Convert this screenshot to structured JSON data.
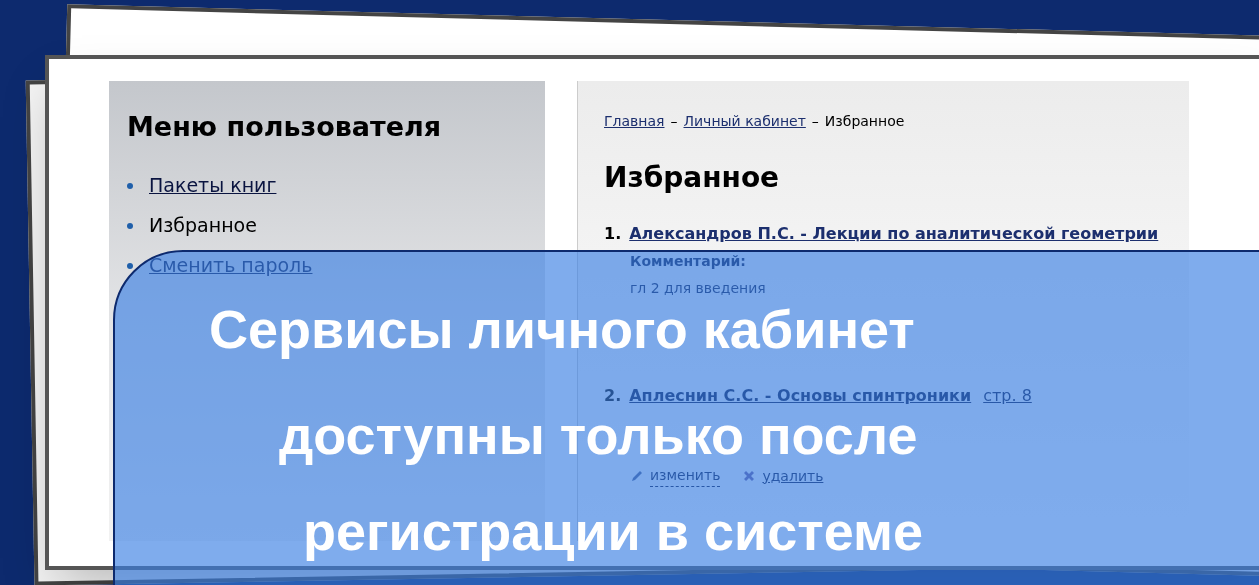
{
  "sidebar": {
    "title": "Меню пользователя",
    "items": [
      {
        "label": "Пакеты книг",
        "selected": false
      },
      {
        "label": "Избранное",
        "selected": true
      },
      {
        "label": "Сменить пароль",
        "selected": false
      }
    ]
  },
  "breadcrumb": {
    "separator": "–",
    "items": [
      {
        "label": "Главная",
        "kind": "link"
      },
      {
        "label": "Личный кабинет",
        "kind": "link"
      },
      {
        "label": "Избранное",
        "kind": "current"
      }
    ]
  },
  "page_title": "Избранное",
  "favorites": [
    {
      "number": "1.",
      "title": "Александров П.С. - Лекции по аналитической геометрии",
      "comment_label": "Комментарий:",
      "comment": "гл 2 для введения"
    },
    {
      "number": "2.",
      "title": "Аплеснин С.С. - Основы спинтроники",
      "page": "стр. 8",
      "actions": [
        {
          "kind": "edit",
          "label": "изменить"
        },
        {
          "kind": "delete",
          "label": "удалить"
        }
      ]
    }
  ],
  "caption": [
    "Сервисы личного кабинет",
    "доступны только после",
    "регистрации в системе"
  ]
}
